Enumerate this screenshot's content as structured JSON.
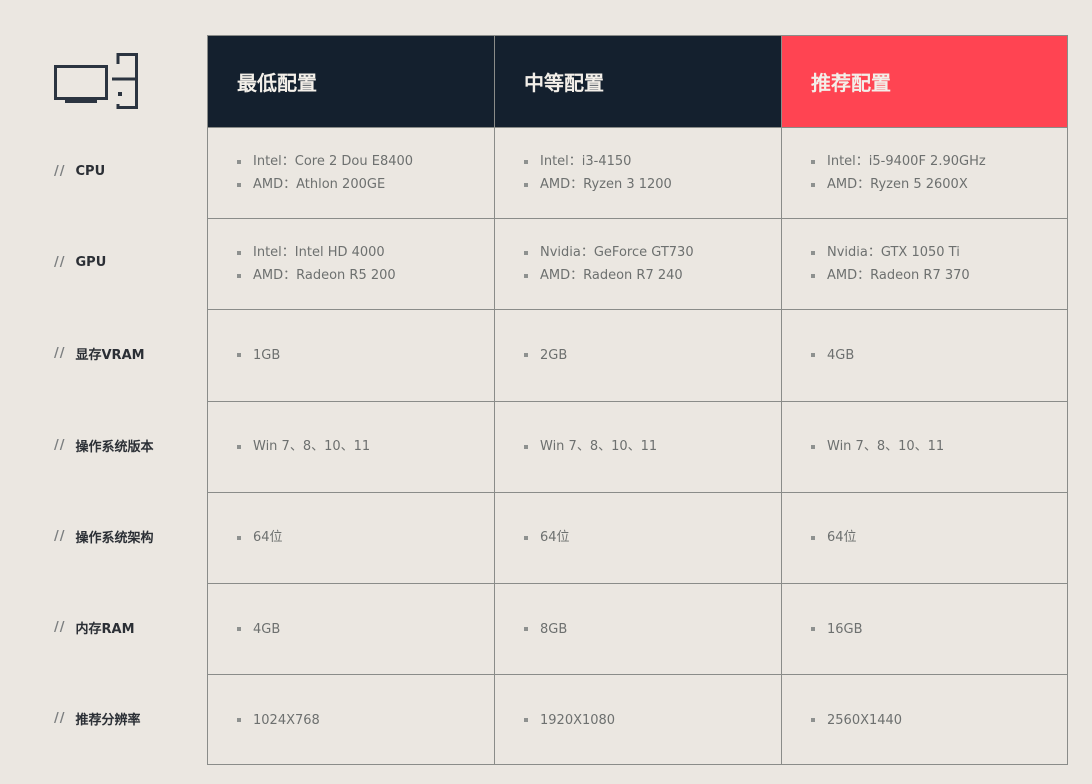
{
  "icon": "desktop-computer-icon",
  "columns": [
    {
      "label": "最低配置",
      "color": "#14202e"
    },
    {
      "label": "中等配置",
      "color": "#14202e"
    },
    {
      "label": "推荐配置",
      "color": "#ff4452"
    }
  ],
  "row_prefix": "//",
  "rows": [
    {
      "label": "CPU",
      "values": [
        [
          "Intel：Core 2 Dou E8400",
          "AMD：Athlon 200GE"
        ],
        [
          "Intel：i3-4150",
          "AMD：Ryzen 3 1200"
        ],
        [
          "Intel：i5-9400F 2.90GHz",
          "AMD：Ryzen 5 2600X"
        ]
      ]
    },
    {
      "label": "GPU",
      "values": [
        [
          "Intel：Intel HD 4000",
          "AMD：Radeon R5 200"
        ],
        [
          "Nvidia：GeForce GT730",
          "AMD：Radeon R7 240"
        ],
        [
          "Nvidia：GTX 1050 Ti",
          "AMD：Radeon R7 370"
        ]
      ]
    },
    {
      "label": "显存VRAM",
      "values": [
        [
          "1GB"
        ],
        [
          "2GB"
        ],
        [
          "4GB"
        ]
      ]
    },
    {
      "label": "操作系统版本",
      "values": [
        [
          "Win 7、8、10、11"
        ],
        [
          "Win 7、8、10、11"
        ],
        [
          "Win 7、8、10、11"
        ]
      ]
    },
    {
      "label": "操作系统架构",
      "values": [
        [
          "64位"
        ],
        [
          "64位"
        ],
        [
          "64位"
        ]
      ]
    },
    {
      "label": "内存RAM",
      "values": [
        [
          "4GB"
        ],
        [
          "8GB"
        ],
        [
          "16GB"
        ]
      ]
    },
    {
      "label": "推荐分辨率",
      "values": [
        [
          "1024X768"
        ],
        [
          "1920X1080"
        ],
        [
          "2560X1440"
        ]
      ]
    }
  ]
}
